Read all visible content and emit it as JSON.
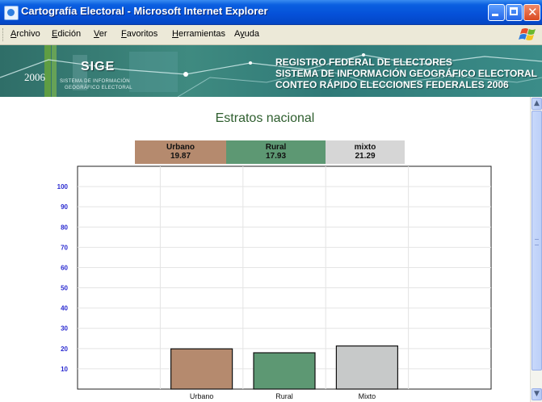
{
  "window": {
    "title": "Cartografía Electoral - Microsoft Internet Explorer",
    "icon": "ie-icon"
  },
  "menu": {
    "items": [
      {
        "label": "Archivo",
        "accel": "A",
        "rest": "rchivo"
      },
      {
        "label": "Edición",
        "accel": "E",
        "rest": "dición"
      },
      {
        "label": "Ver",
        "accel": "V",
        "rest": "er"
      },
      {
        "label": "Favoritos",
        "accel": "F",
        "rest": "avoritos"
      },
      {
        "label": "Herramientas",
        "accel": "H",
        "rest": "erramientas"
      },
      {
        "label": "Ayuda",
        "accel": "y",
        "pre": "A",
        "rest": "uda"
      }
    ]
  },
  "banner": {
    "year": "2006",
    "logo": "SIGE",
    "subtitle_line1": "SISTEMA DE INFORMACIÓN",
    "subtitle_line2": "GEOGRÁFICO ELECTORAL",
    "line1": "REGISTRO FEDERAL DE ELECTORES",
    "line2": "SISTEMA DE INFORMACIÓN GEOGRÁFICO ELECTORAL",
    "line3": "CONTEO RÁPIDO ELECCIONES FEDERALES 2006"
  },
  "chart_data": {
    "type": "bar",
    "title": "Estratos nacional",
    "categories": [
      "Urbano",
      "Rural",
      "Mixto"
    ],
    "legend": [
      {
        "name": "Urbano",
        "value_label": "19.87",
        "color": "#b58a6e"
      },
      {
        "name": "Rural",
        "value_label": "17.93",
        "color": "#5d9873"
      },
      {
        "name": "mixto",
        "value_label": "21.29",
        "color": "#d6d6d6"
      }
    ],
    "values": [
      19.87,
      17.93,
      21.29
    ],
    "colors": [
      "#b58a6e",
      "#5d9873",
      "#c7c9c9"
    ],
    "yticks": [
      10,
      20,
      30,
      40,
      50,
      60,
      70,
      80,
      90,
      100
    ],
    "ylim": [
      0,
      110
    ],
    "grid": true
  }
}
